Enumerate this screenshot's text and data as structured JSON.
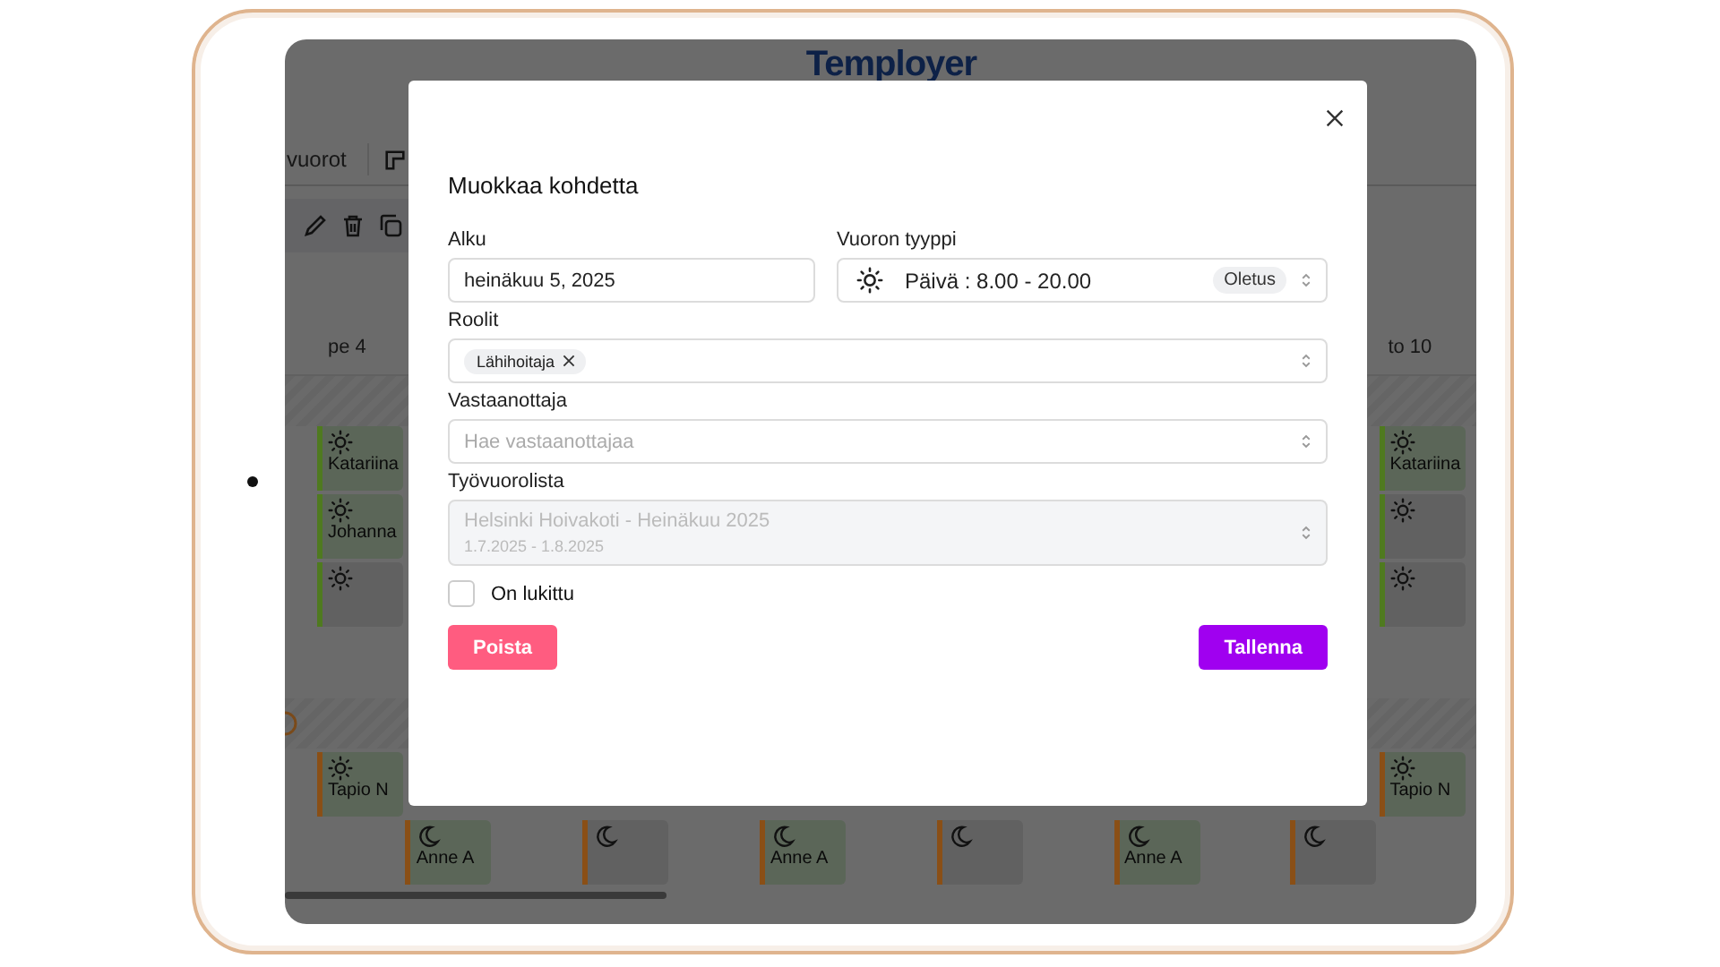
{
  "app": {
    "logo": "Temployer",
    "view_tab": "vuorot",
    "day_headers": [
      {
        "label": "pe 4"
      },
      {
        "label": "to 10"
      }
    ],
    "rows": [
      {
        "kind": "shifts",
        "left": {
          "kind": "day",
          "name": "Katariina",
          "color": "#4f7a1f"
        },
        "right": {
          "kind": "day",
          "name": "Katariina",
          "color": "#4f7a1f"
        }
      },
      {
        "kind": "shifts",
        "left": {
          "kind": "day",
          "name": "Johanna",
          "color": "#4f7a1f"
        },
        "right": {
          "kind": "day",
          "color": "#4f7a1f"
        }
      },
      {
        "kind": "shifts",
        "left": {
          "kind": "day",
          "color": "#4f7a1f"
        },
        "right": {
          "kind": "day",
          "color": "#4f7a1f"
        }
      },
      {
        "kind": "empty"
      },
      {
        "kind": "group"
      },
      {
        "kind": "shifts",
        "left": {
          "kind": "day",
          "name": "Tapio N",
          "color": "#8a4f16"
        },
        "right": {
          "kind": "day",
          "name": "Tapio N",
          "color": "#8a4f16"
        }
      },
      {
        "kind": "spread",
        "cards": [
          {
            "kind": "night",
            "name": "Anne A",
            "color": "#8a4f16"
          },
          {
            "kind": "night",
            "color": "#8a4f16"
          },
          {
            "kind": "night",
            "name": "Anne A",
            "color": "#8a4f16"
          },
          {
            "kind": "night",
            "color": "#8a4f16"
          },
          {
            "kind": "night",
            "name": "Anne A",
            "color": "#8a4f16"
          },
          {
            "kind": "night",
            "color": "#8a4f16"
          }
        ]
      }
    ]
  },
  "dialog": {
    "title": "Muokkaa kohdetta",
    "start": {
      "label": "Alku",
      "value": "heinäkuu 5, 2025"
    },
    "shift_type": {
      "label": "Vuoron tyyppi",
      "kind": "day",
      "value": "Päivä : 8.00 - 20.00",
      "badge": "Oletus"
    },
    "roles": {
      "label": "Roolit",
      "chips": [
        "Lähihoitaja"
      ]
    },
    "recipient": {
      "label": "Vastaanottaja",
      "placeholder": "Hae vastaanottajaa"
    },
    "schedule": {
      "label": "Työvuorolista",
      "value": "Helsinki Hoivakoti - Heinäkuu 2025",
      "dates": "1.7.2025 - 1.8.2025",
      "disabled": true
    },
    "locked": {
      "label": "On lukittu",
      "checked": false
    },
    "buttons": [
      {
        "label": "Poista",
        "kind": "danger"
      },
      {
        "label": "Tallenna",
        "kind": "primary"
      }
    ]
  }
}
